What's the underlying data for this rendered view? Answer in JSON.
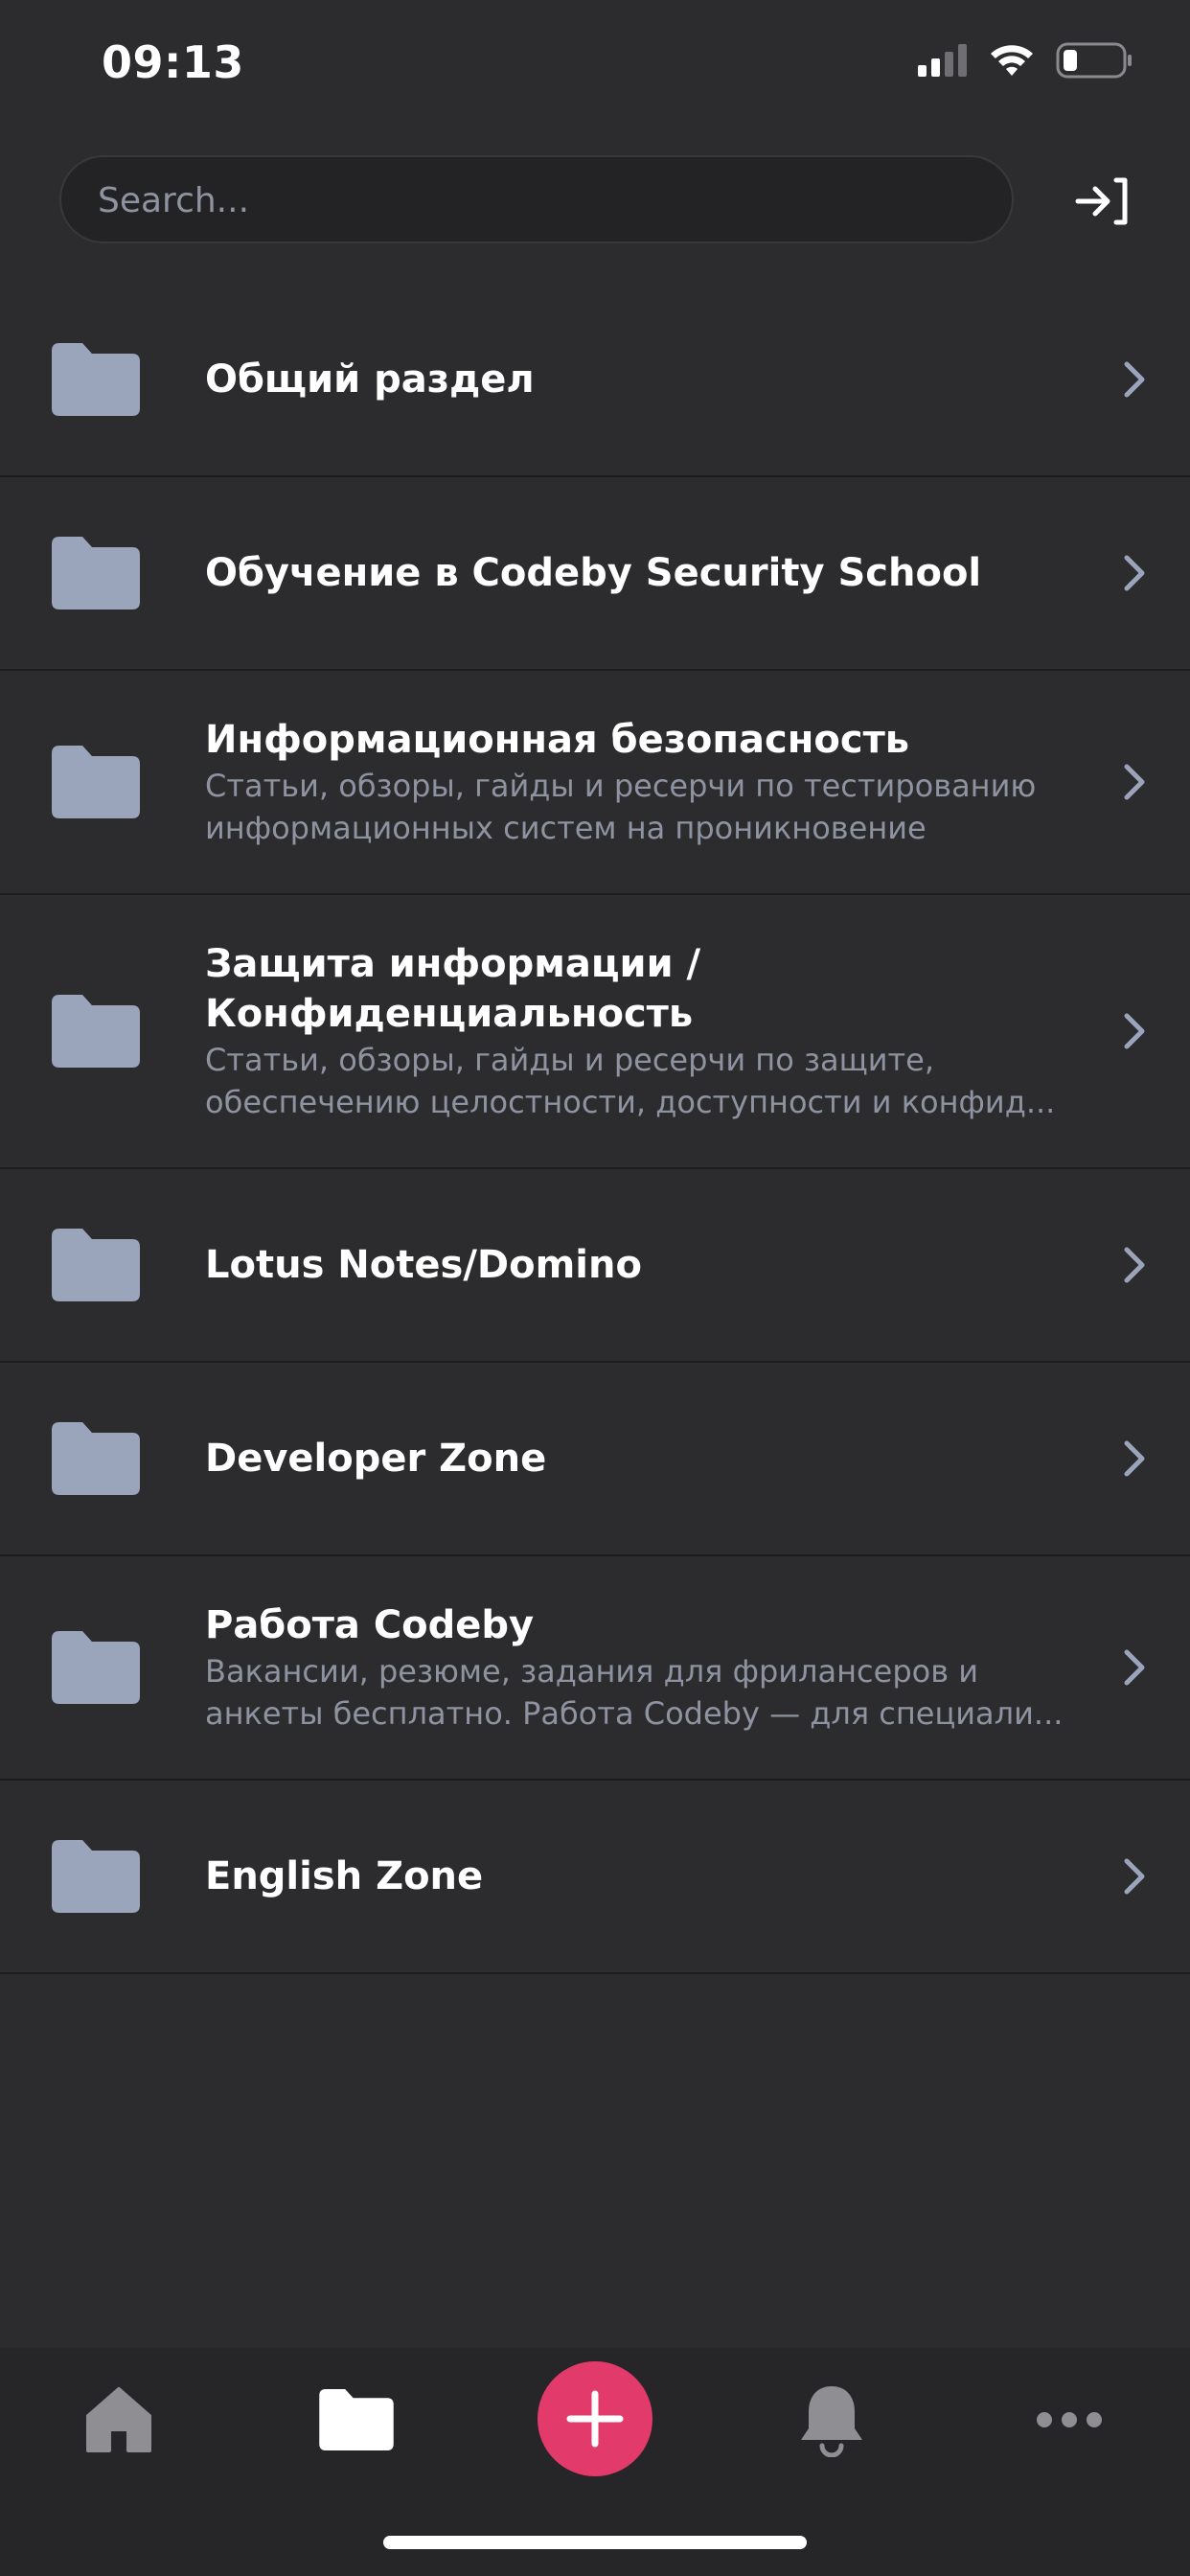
{
  "status_bar": {
    "time": "09:13",
    "icons": [
      "signal-icon",
      "wifi-icon",
      "battery-icon"
    ]
  },
  "search": {
    "placeholder": "Search...",
    "value": ""
  },
  "header": {
    "login_icon": "login-arrow-icon"
  },
  "forums": [
    {
      "title": "Общий раздел",
      "description": ""
    },
    {
      "title": "Обучение в Codeby Security School",
      "description": ""
    },
    {
      "title": "Информационная безопасность",
      "description": [
        "Статьи, обзоры, гайды и ресерчи по тестированию",
        "информационных систем на проникновение"
      ]
    },
    {
      "title": [
        "Защита информации /",
        "Конфиденциальность"
      ],
      "description": [
        "Статьи, обзоры, гайды и ресерчи по защите,",
        "обеспечению целостности, доступности и конфид..."
      ]
    },
    {
      "title": "Lotus Notes/Domino",
      "description": ""
    },
    {
      "title": "Developer Zone",
      "description": ""
    },
    {
      "title": "Работа Codeby",
      "description": [
        "Вакансии, резюме, задания для фрилансеров и",
        "анкеты бесплатно. Работа Codeby — для специали..."
      ]
    },
    {
      "title": "English Zone",
      "description": ""
    }
  ],
  "tab_bar": {
    "items": [
      "home-icon",
      "folder-icon",
      "plus-icon",
      "bell-icon",
      "more-icon"
    ],
    "active": "folder-icon",
    "accent": "#e23a6b"
  },
  "colors": {
    "background": "#2c2c2e",
    "folder": "#9aa4ba",
    "secondary_text": "#8d93a0",
    "chevron": "#9aa4ba"
  }
}
